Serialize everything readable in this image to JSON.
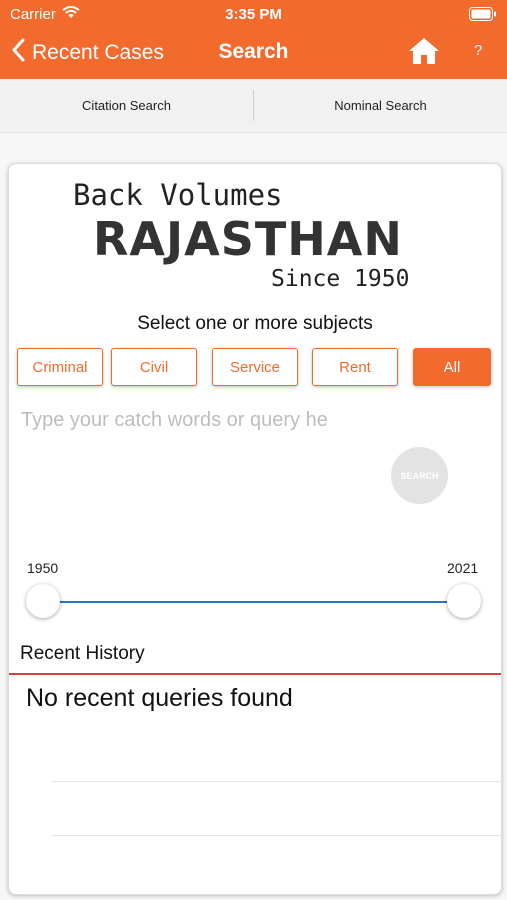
{
  "status_bar": {
    "carrier": "Carrier",
    "time": "3:35 PM"
  },
  "nav": {
    "back_label": "Recent Cases",
    "title": "Search",
    "help_label": "?",
    "home_icon": "home-icon",
    "color": "#f36a2d"
  },
  "tabs": [
    {
      "label": "Citation Search"
    },
    {
      "label": "Nominal Search"
    }
  ],
  "logo": {
    "line1": "Back Volumes",
    "line2": "RAJASTHAN",
    "line3": "Since 1950"
  },
  "subjects": {
    "title": "Select one or more subjects",
    "items": [
      {
        "label": "Criminal",
        "selected": false
      },
      {
        "label": "Civil",
        "selected": false
      },
      {
        "label": "Service",
        "selected": false
      },
      {
        "label": "Rent",
        "selected": false
      },
      {
        "label": "All",
        "selected": true
      }
    ]
  },
  "query": {
    "placeholder": "Type your catch words or query he"
  },
  "search_button": {
    "label": "SEARCH"
  },
  "year_range": {
    "min_label": "1950",
    "max_label": "2021",
    "track_color": "#1f78d1"
  },
  "history": {
    "title": "Recent History",
    "empty_text": "No recent queries found"
  }
}
